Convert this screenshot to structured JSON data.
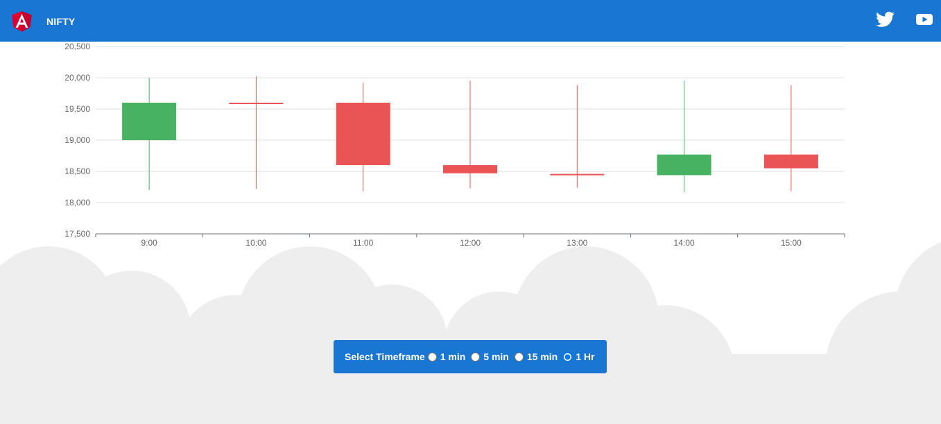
{
  "header": {
    "title": "NIFTY",
    "logo_icon": "angular-logo-icon",
    "links": [
      {
        "name": "twitter",
        "icon": "twitter-icon"
      },
      {
        "name": "youtube",
        "icon": "youtube-icon"
      }
    ]
  },
  "colors": {
    "header_bg": "#1976d2",
    "bullish": "#47b262",
    "bearish": "#eb5454",
    "cloud": "#eeeeee"
  },
  "chart_data": {
    "type": "candlestick",
    "title": "",
    "xlabel": "",
    "ylabel": "",
    "categories": [
      "9:00",
      "10:00",
      "11:00",
      "12:00",
      "13:00",
      "14:00",
      "15:00"
    ],
    "ohlc": [
      {
        "open": 19000,
        "close": 19600,
        "low": 18200,
        "high": 20000
      },
      {
        "open": 19600,
        "close": 19590,
        "low": 18220,
        "high": 20020
      },
      {
        "open": 19600,
        "close": 18600,
        "low": 18180,
        "high": 19920
      },
      {
        "open": 18600,
        "close": 18470,
        "low": 18230,
        "high": 19950
      },
      {
        "open": 18460,
        "close": 18440,
        "low": 18240,
        "high": 19880
      },
      {
        "open": 18440,
        "close": 18770,
        "low": 18170,
        "high": 19950
      },
      {
        "open": 18770,
        "close": 18550,
        "low": 18180,
        "high": 19880
      }
    ],
    "yticks": [
      "17,500",
      "18,000",
      "18,500",
      "19,000",
      "19,500",
      "20,000",
      "20,500"
    ],
    "ylim": [
      17500,
      20500
    ],
    "grid": true
  },
  "timeframe": {
    "label": "Select Timeframe",
    "options": [
      {
        "label": "1 min",
        "selected": false
      },
      {
        "label": "5 min",
        "selected": false
      },
      {
        "label": "15 min",
        "selected": false
      },
      {
        "label": "1 Hr",
        "selected": true
      }
    ]
  }
}
